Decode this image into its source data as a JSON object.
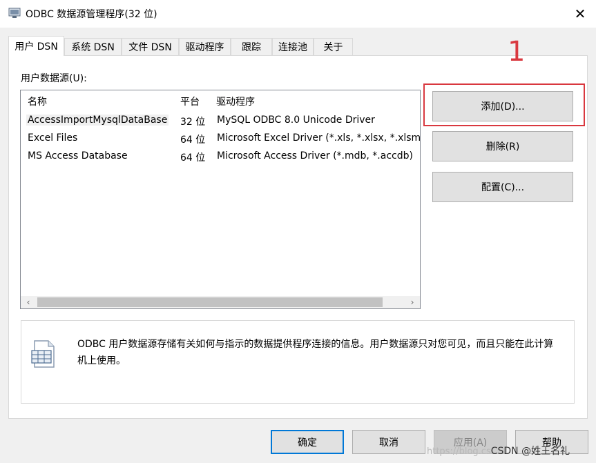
{
  "window": {
    "title": "ODBC 数据源管理程序(32 位)",
    "close_label": "✕"
  },
  "tabs": [
    {
      "label": "用户 DSN",
      "active": true
    },
    {
      "label": "系统 DSN"
    },
    {
      "label": "文件 DSN"
    },
    {
      "label": "驱动程序"
    },
    {
      "label": "跟踪"
    },
    {
      "label": "连接池"
    },
    {
      "label": "关于"
    }
  ],
  "user_dsn": {
    "section_label": "用户数据源(U):",
    "columns": [
      "名称",
      "平台",
      "驱动程序"
    ],
    "rows": [
      {
        "name": "AccessImportMysqlDataBase",
        "platform": "32 位",
        "driver": "MySQL ODBC 8.0 Unicode Driver"
      },
      {
        "name": "Excel Files",
        "platform": "64 位",
        "driver": "Microsoft Excel Driver (*.xls, *.xlsx, *.xlsm, *.xlsb)"
      },
      {
        "name": "MS Access Database",
        "platform": "64 位",
        "driver": "Microsoft Access Driver (*.mdb, *.accdb)"
      }
    ],
    "scroll_left": "‹",
    "scroll_right": "›"
  },
  "side_buttons": {
    "add": "添加(D)...",
    "remove": "删除(R)",
    "configure": "配置(C)..."
  },
  "annotation": {
    "number": "1",
    "color": "#d9383f"
  },
  "info": {
    "text": "ODBC 用户数据源存储有关如何与指示的数据提供程序连接的信息。用户数据源只对您可见，而且只能在此计算机上使用。"
  },
  "bottom_buttons": {
    "ok": "确定",
    "cancel": "取消",
    "apply": "应用(A)",
    "help": "帮助"
  },
  "watermark": {
    "url": "https://blog.cs",
    "brand": "CSDN @姓王名礼"
  }
}
